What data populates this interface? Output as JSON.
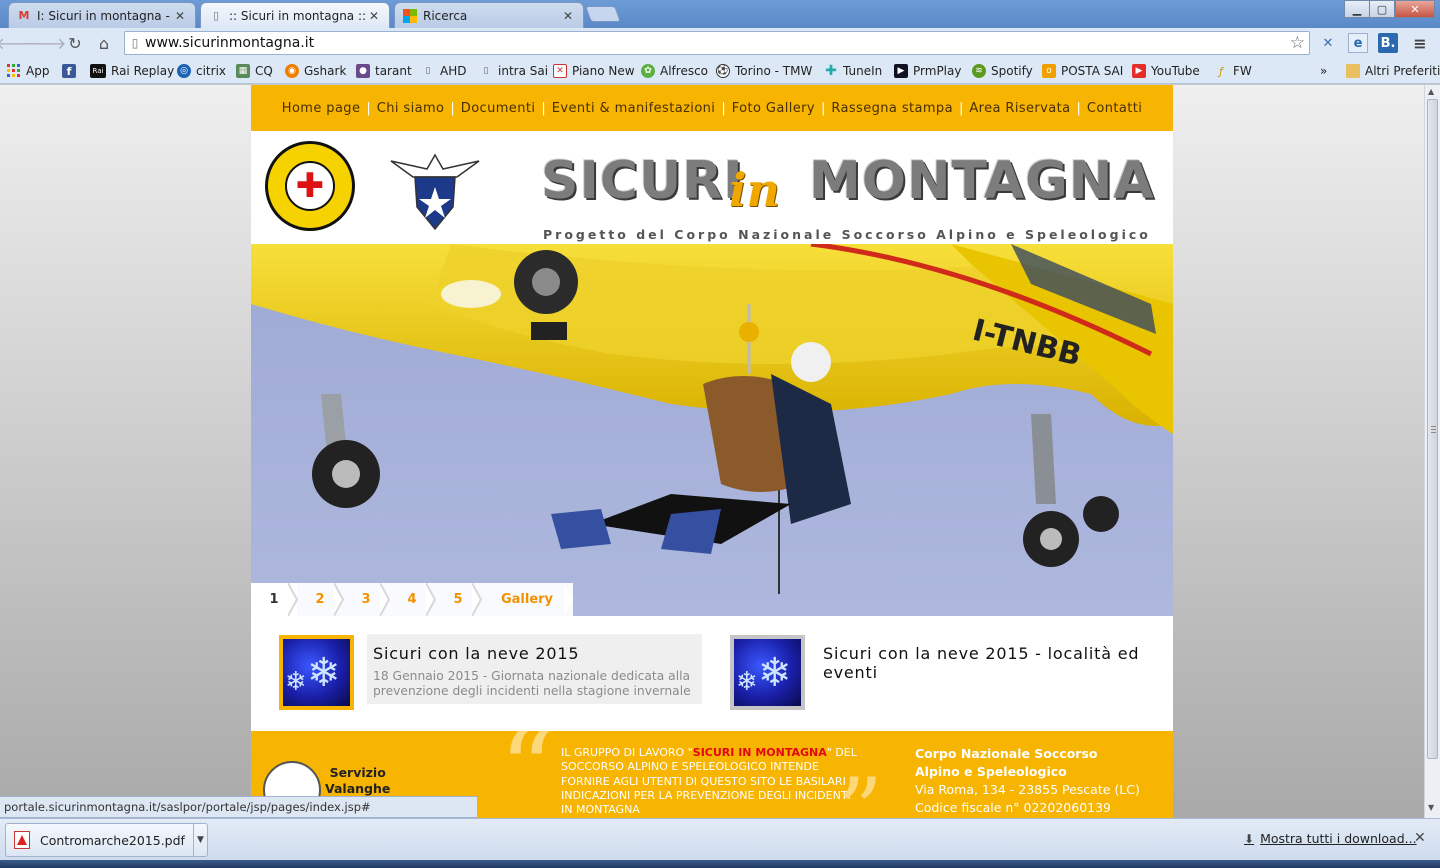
{
  "browser": {
    "tabs": [
      {
        "title": "I: Sicuri in montagna - jac",
        "icon": "gmail-icon"
      },
      {
        "title": ":: Sicuri in montagna ::",
        "icon": "page-icon"
      },
      {
        "title": "Ricerca",
        "icon": "ricerca-icon"
      }
    ],
    "url": "www.sicurinmontagna.it",
    "bookmarks": [
      "App",
      "Rai Replay",
      "citrix",
      "CQ",
      "Gshark",
      "tarant",
      "AHD",
      "intra Sai",
      "Piano New",
      "Alfresco",
      "Torino - TMW",
      "TuneIn",
      "PrmPlay",
      "Spotify",
      "POSTA SAI",
      "YouTube",
      "FW"
    ],
    "bookmarks_overflow": "»",
    "other_bookmarks": "Altri Preferiti",
    "window_controls": {
      "minimize": "▁",
      "maximize": "▢",
      "close": "✕"
    }
  },
  "site": {
    "nav": [
      "Home page",
      "Chi siamo",
      "Documenti",
      "Eventi & manifestazioni",
      "Foto Gallery",
      "Rassegna stampa",
      "Area Riservata",
      "Contatti"
    ],
    "brand_left": "SICURI",
    "brand_mid": "in",
    "brand_right": "MONTAGNA",
    "tagline": "Progetto del Corpo Nazionale Soccorso Alpino e Speleologico",
    "hero": {
      "helicopter_reg": "I-TNBB"
    },
    "slider_tabs": [
      "1",
      "2",
      "3",
      "4",
      "5",
      "Gallery"
    ],
    "news": [
      {
        "title": "Sicuri con la neve 2015",
        "desc": "18 Gennaio 2015 - Giornata nazionale dedicata alla prevenzione degli incidenti nella stagione invernale"
      },
      {
        "title": "Sicuri con la neve 2015 - località ed eventi",
        "desc": ""
      }
    ],
    "footer": {
      "servizio_line1": "Servizio",
      "servizio_line2": "Valanghe",
      "quote_pre": "Il gruppo di lavoro \"",
      "quote_hl": "Sicuri in Montagna",
      "quote_post": "\" del Soccorso Alpino e Speleologico intende fornire agli utenti di questo sito le basilari indicazioni per la prevenzione degli incidenti in montagna",
      "addr1": "Corpo Nazionale Soccorso",
      "addr2": "Alpino e Speleologico",
      "addr3": "Via Roma, 134 - 23855 Pescate (LC)",
      "addr4": "Codice fiscale n° 02202060139"
    }
  },
  "status_url": "portale.sicurinmontagna.it/saslpor/portale/jsp/pages/index.jsp#",
  "downloads": {
    "file": "Contromarche2015.pdf",
    "show_all": "Mostra tutti i download..."
  }
}
